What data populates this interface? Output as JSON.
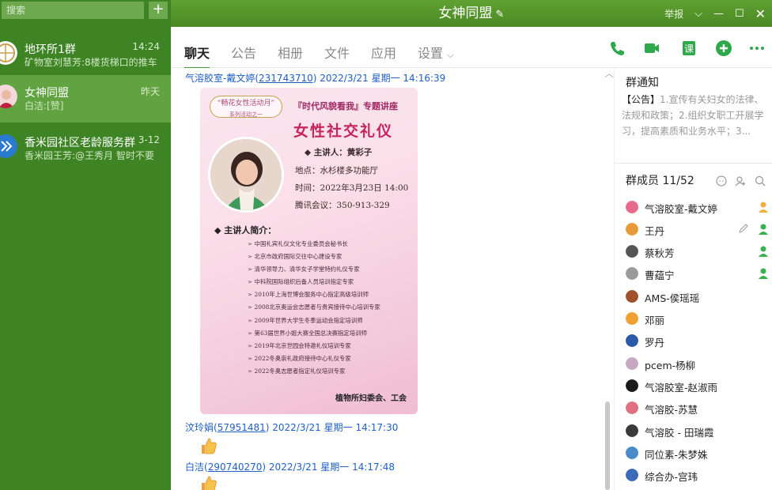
{
  "window": {
    "title": "女神同盟",
    "report_label": "举报"
  },
  "sidebar": {
    "search_placeholder": "搜索",
    "conversations": [
      {
        "name": "地环所1群",
        "time": "14:24",
        "preview": "矿物室刘慧芳:8楼货梯口的推车"
      },
      {
        "name": "女神同盟",
        "time": "昨天",
        "preview": "白洁:[赞]"
      },
      {
        "name": "香米园社区老龄服务群",
        "time": "3-12",
        "preview": "香米园王芳:@王秀月 智时不要"
      }
    ]
  },
  "tabs": [
    "聊天",
    "公告",
    "相册",
    "文件",
    "应用",
    "设置"
  ],
  "messages": [
    {
      "sender": "气溶胶室-戴文婷",
      "uid": "231743710",
      "time": "2022/3/21 星期一 14:16:39"
    },
    {
      "sender": "汶玲娟",
      "uid": "57951481",
      "time": "2022/3/21 星期一 14:17:30"
    },
    {
      "sender": "白洁",
      "uid": "290740270",
      "time": "2022/3/21 星期一 14:17:48"
    }
  ],
  "poster": {
    "tag1_line1": "“畅花女性活动月”",
    "tag1_line2": "系列活动之一",
    "tag2": "『时代风貌看我』专题讲座",
    "title": "女性社交礼仪",
    "speaker": "◆ 主讲人：黄彩子",
    "place": "地点：水杉楼多功能厅",
    "date": "时间：2022年3月23日 14:00",
    "meeting": "腾讯会议：350-913-329",
    "intro_label": "◆ 主讲人简介：",
    "bio": [
      "中国礼宾礼仪文化专业委员会秘书长",
      "北京市政府国际交往中心建设专家",
      "清华领导力、清华女子学堂特约礼仪专家",
      "中科院国际组织后备人员培训指定专家",
      "2010年上海世博会服务中心指定高级培训师",
      "2008北京奥运会志愿者与贵宾接待中心培训专家",
      "2009年世界大学生冬季运动会指定培训师",
      "第63届世界小姐大赛全国总决赛指定培训师",
      "2019年北京世园会特邀礼仪培训专家",
      "2022冬奥崇礼政府接待中心礼仪专家",
      "2022冬奥志愿者指定礼仪培训专家"
    ],
    "footer": "植物所妇委会、工会"
  },
  "right_panel": {
    "notice_title": "群通知",
    "notice_label": "【公告】",
    "notice_text": "1.宣传有关妇女的法律、法规和政策；2.组织女职工开展学习，提高素质和业务水平；3...",
    "members_title": "群成员 11/52",
    "members": [
      {
        "name": "气溶胶室-戴文婷",
        "color": "#e86a8a"
      },
      {
        "name": "王丹",
        "color": "#e89a3a"
      },
      {
        "name": "蔡秋芳",
        "color": "#555555"
      },
      {
        "name": "曹蕴宁",
        "color": "#9a9a9a"
      },
      {
        "name": "AMS-侯瑶瑶",
        "color": "#a0522d"
      },
      {
        "name": "邓丽",
        "color": "#f0a030"
      },
      {
        "name": "罗丹",
        "color": "#2a5aa8"
      },
      {
        "name": "pcem-杨柳",
        "color": "#c8a8c0"
      },
      {
        "name": "气溶胶室-赵淑雨",
        "color": "#1a1a1a"
      },
      {
        "name": "气溶胶-苏慧",
        "color": "#e07080"
      },
      {
        "name": "气溶胶 - 田瑞霞",
        "color": "#3a3a3a"
      },
      {
        "name": "同位素-朱梦姝",
        "color": "#4a8ac8"
      },
      {
        "name": "综合办-宫玮",
        "color": "#3a6ab8"
      }
    ]
  },
  "colors": {
    "brand_green": "#3e8324",
    "link_blue": "#2060c8",
    "tab_active": "#3a9a2c"
  }
}
